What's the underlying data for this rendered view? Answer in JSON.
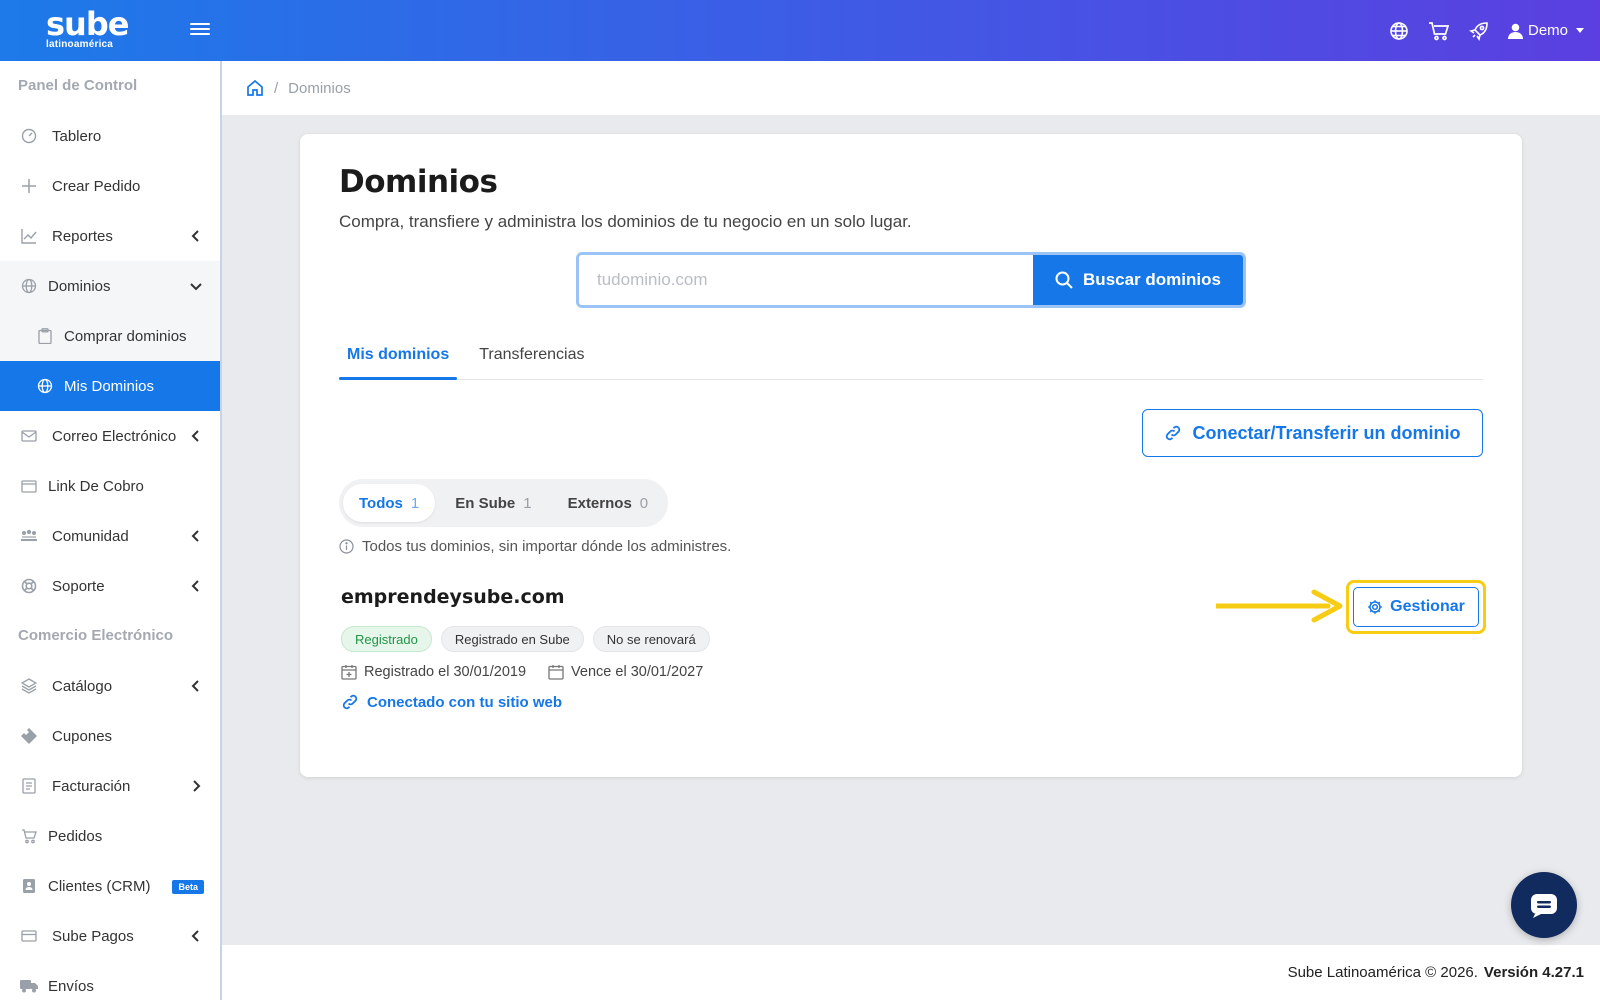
{
  "topbar": {
    "logo_main": "sube",
    "logo_sub": "latinoamérica",
    "user_name": "Demo"
  },
  "sidebar": {
    "section_panel": "Panel de Control",
    "section_commerce": "Comercio Electrónico",
    "items": [
      {
        "label": "Tablero",
        "icon": "gauge-icon"
      },
      {
        "label": "Crear Pedido",
        "icon": "plus-icon"
      },
      {
        "label": "Reportes",
        "icon": "chart-icon"
      },
      {
        "label": "Dominios",
        "icon": "globe-icon"
      },
      {
        "label": "Comprar dominios",
        "icon": "clipboard-icon"
      },
      {
        "label": "Mis Dominios",
        "icon": "globe-icon"
      },
      {
        "label": "Correo Electrónico",
        "icon": "mail-icon"
      },
      {
        "label": "Link De Cobro",
        "icon": "wallet-icon"
      },
      {
        "label": "Comunidad",
        "icon": "community-icon"
      },
      {
        "label": "Soporte",
        "icon": "lifebuoy-icon"
      },
      {
        "label": "Catálogo",
        "icon": "layers-icon"
      },
      {
        "label": "Cupones",
        "icon": "ticket-icon"
      },
      {
        "label": "Facturación",
        "icon": "invoice-icon"
      },
      {
        "label": "Pedidos",
        "icon": "cart-icon"
      },
      {
        "label": "Clientes (CRM)",
        "icon": "contact-icon",
        "badge": "Beta"
      },
      {
        "label": "Sube Pagos",
        "icon": "card-icon"
      },
      {
        "label": "Envíos",
        "icon": "truck-icon"
      }
    ]
  },
  "breadcrumb": {
    "separator": "/",
    "current": "Dominios"
  },
  "main": {
    "title": "Dominios",
    "subtitle": "Compra, transfiere y administra los dominios de tu negocio en un solo lugar.",
    "search": {
      "placeholder": "tudominio.com",
      "value": "",
      "button_label": "Buscar dominios"
    },
    "tabs": [
      {
        "label": "Mis dominios",
        "active": true
      },
      {
        "label": "Transferencias",
        "active": false
      }
    ],
    "connect_button": "Conectar/Transferir un dominio",
    "filters": [
      {
        "label": "Todos",
        "count": "1",
        "active": true
      },
      {
        "label": "En Sube",
        "count": "1",
        "active": false
      },
      {
        "label": "Externos",
        "count": "0",
        "active": false
      }
    ],
    "hint": "Todos tus dominios, sin importar dónde los administres.",
    "domain": {
      "name": "emprendeysube.com",
      "badges": [
        "Registrado",
        "Registrado en Sube",
        "No se renovará"
      ],
      "registered": "Registrado el 30/01/2019",
      "expires": "Vence el 30/01/2027",
      "connected": "Conectado con tu sitio web",
      "manage_label": "Gestionar"
    }
  },
  "footer": {
    "copyright": "Sube Latinoamérica © 2026.",
    "version": "Versión 4.27.1"
  },
  "colors": {
    "accent": "#1677e8",
    "highlight": "#f6cc14",
    "success": "#239447"
  }
}
